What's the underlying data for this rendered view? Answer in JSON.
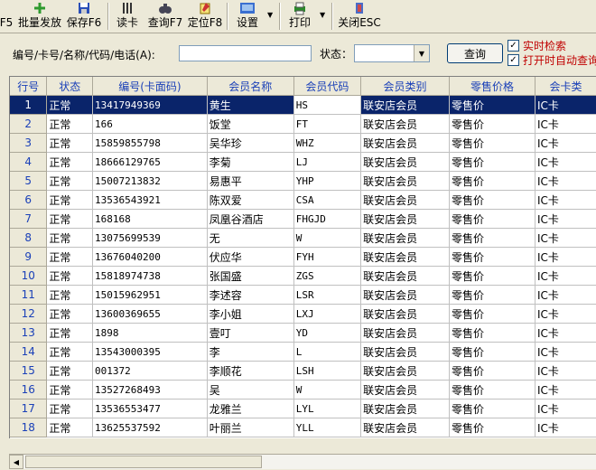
{
  "toolbar": {
    "items": [
      {
        "label": "F5",
        "icon": "refresh-icon"
      },
      {
        "label": "批量发放",
        "icon": "batch-issue-icon"
      },
      {
        "label": "保存F6",
        "icon": "save-icon"
      },
      {
        "label": "读卡",
        "icon": "card-reader-icon"
      },
      {
        "label": "查询F7",
        "icon": "binoculars-icon"
      },
      {
        "label": "定位F8",
        "icon": "locate-icon"
      },
      {
        "label": "设置",
        "icon": "settings-icon"
      },
      {
        "label": "打印",
        "icon": "printer-icon"
      },
      {
        "label": "关闭ESC",
        "icon": "exit-icon"
      }
    ]
  },
  "search": {
    "label": "编号/卡号/名称/代码/电话(A):",
    "value": "",
    "status_label": "状态：",
    "status_value": "",
    "query_label": "查询",
    "realtime_label": "实时检索",
    "auto_query_label": "打开时自动查询"
  },
  "table": {
    "columns": [
      "行号",
      "状态",
      "编号(卡面码)",
      "会员名称",
      "会员代码",
      "会员类别",
      "零售价格",
      "会卡类"
    ],
    "rows": [
      [
        "1",
        "正常",
        "13417949369",
        "黄生",
        "HS",
        "联安店会员",
        "零售价",
        "IC卡"
      ],
      [
        "2",
        "正常",
        "166",
        "饭堂",
        "FT",
        "联安店会员",
        "零售价",
        "IC卡"
      ],
      [
        "3",
        "正常",
        "15859855798",
        "吴华珍",
        "WHZ",
        "联安店会员",
        "零售价",
        "IC卡"
      ],
      [
        "4",
        "正常",
        "18666129765",
        "李菊",
        "LJ",
        "联安店会员",
        "零售价",
        "IC卡"
      ],
      [
        "5",
        "正常",
        "15007213832",
        "易惠平",
        "YHP",
        "联安店会员",
        "零售价",
        "IC卡"
      ],
      [
        "6",
        "正常",
        "13536543921",
        "陈双爱",
        "CSA",
        "联安店会员",
        "零售价",
        "IC卡"
      ],
      [
        "7",
        "正常",
        "168168",
        "凤凰谷酒店",
        "FHGJD",
        "联安店会员",
        "零售价",
        "IC卡"
      ],
      [
        "8",
        "正常",
        "13075699539",
        "无",
        "W",
        "联安店会员",
        "零售价",
        "IC卡"
      ],
      [
        "9",
        "正常",
        "13676040200",
        "伏应华",
        "FYH",
        "联安店会员",
        "零售价",
        "IC卡"
      ],
      [
        "10",
        "正常",
        "15818974738",
        "张国盛",
        "ZGS",
        "联安店会员",
        "零售价",
        "IC卡"
      ],
      [
        "11",
        "正常",
        "15015962951",
        "李述容",
        "LSR",
        "联安店会员",
        "零售价",
        "IC卡"
      ],
      [
        "12",
        "正常",
        "13600369655",
        "李小姐",
        "LXJ",
        "联安店会员",
        "零售价",
        "IC卡"
      ],
      [
        "13",
        "正常",
        "1898",
        "壹叮",
        "YD",
        "联安店会员",
        "零售价",
        "IC卡"
      ],
      [
        "14",
        "正常",
        "13543000395",
        "李",
        "L",
        "联安店会员",
        "零售价",
        "IC卡"
      ],
      [
        "15",
        "正常",
        "001372",
        "李顺花",
        "LSH",
        "联安店会员",
        "零售价",
        "IC卡"
      ],
      [
        "16",
        "正常",
        "13527268493",
        "吴",
        "W",
        "联安店会员",
        "零售价",
        "IC卡"
      ],
      [
        "17",
        "正常",
        "13536553477",
        "龙雅兰",
        "LYL",
        "联安店会员",
        "零售价",
        "IC卡"
      ],
      [
        "18",
        "正常",
        "13625537592",
        "叶丽兰",
        "YLL",
        "联安店会员",
        "零售价",
        "IC卡"
      ]
    ]
  },
  "colors": {
    "selected_row": "#0a246a",
    "header_text": "#1a40b8",
    "checkbox_label": "#c00000"
  }
}
